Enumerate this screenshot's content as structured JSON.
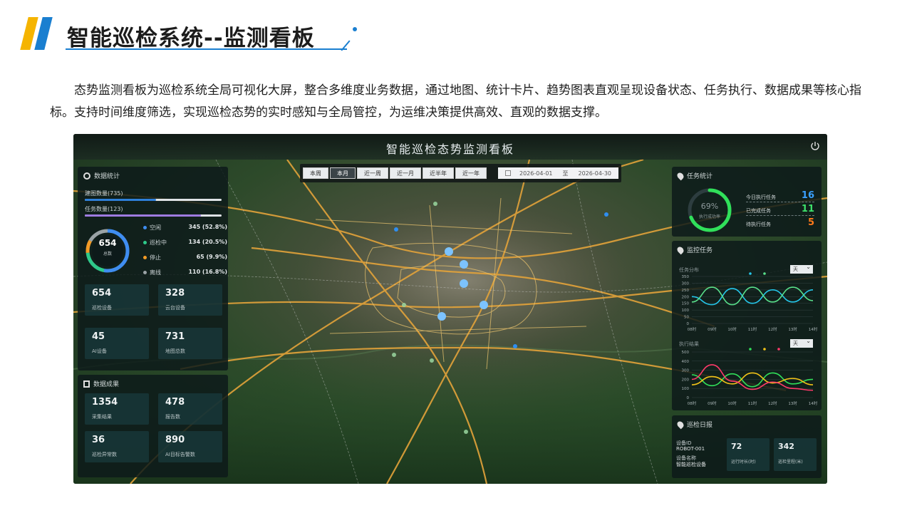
{
  "slide": {
    "title": "智能巡检系统--监测看板",
    "description": "态势监测看板为巡检系统全局可视化大屏，整合多维度业务数据，通过地图、统计卡片、趋势图表直观呈现设备状态、任务执行、数据成果等核心指标。支持时间维度筛选，实现巡检态势的实时感知与全局管控，为运维决策提供高效、直观的数据支撑。"
  },
  "dashboard": {
    "title": "智能巡检态势监测看板",
    "time_tabs": [
      "本周",
      "本月",
      "近一周",
      "近一月",
      "近半年",
      "近一年"
    ],
    "active_tab": "本月",
    "date_start": "2026-04-01",
    "date_sep": "至",
    "date_end": "2026-04-30",
    "device_stats": {
      "title": "数据统计",
      "progress": [
        {
          "label": "建图数量(735)",
          "fraction": 0.52,
          "color": "#2e7fd8"
        },
        {
          "label": "任务数量(123)",
          "fraction": 0.85,
          "color": "#9e7be0"
        }
      ],
      "donut": {
        "value": "654",
        "label": "总数"
      },
      "legend": [
        {
          "name": "空闲",
          "value": "345 (52.8%)",
          "color": "#3f8df0",
          "fraction": 0.528
        },
        {
          "name": "巡检中",
          "value": "134 (20.5%)",
          "color": "#2ec98a",
          "fraction": 0.205
        },
        {
          "name": "停止",
          "value": "65 (9.9%)",
          "color": "#f39b26",
          "fraction": 0.099
        },
        {
          "name": "离线",
          "value": "110 (16.8%)",
          "color": "#9aa3a6",
          "fraction": 0.168
        }
      ],
      "cards": [
        {
          "num": "654",
          "label": "巡检设备"
        },
        {
          "num": "328",
          "label": "云台设备"
        },
        {
          "num": "45",
          "label": "AI设备"
        },
        {
          "num": "731",
          "label": "地图总数"
        }
      ]
    },
    "data_results": {
      "title": "数据成果",
      "cards": [
        {
          "num": "1354",
          "label": "采集结果"
        },
        {
          "num": "478",
          "label": "报告数"
        },
        {
          "num": "36",
          "label": "巡检异常数"
        },
        {
          "num": "890",
          "label": "AI目标告警数"
        }
      ]
    },
    "task_stats": {
      "title": "任务统计",
      "gauge_percent": "69%",
      "gauge_fraction": 0.69,
      "gauge_label": "执行成功率",
      "rows": [
        {
          "label": "今日执行任务",
          "num": "16",
          "color": "#3aa0ff"
        },
        {
          "label": "已完成任务",
          "num": "11",
          "color": "#3ee06b"
        },
        {
          "label": "待执行任务",
          "num": "5",
          "color": "#ff7a1a"
        }
      ]
    },
    "monitor_tasks": {
      "title": "监控任务",
      "chart1_title": "任务分布",
      "chart2_title": "执行结果",
      "select_value": "天"
    },
    "inspection_log": {
      "title": "巡检日报",
      "device_id_label": "设备ID",
      "device_id": "ROBOT-001",
      "device_name_label": "设备名称",
      "device_name": "智能巡检设备",
      "cards": [
        {
          "num": "72",
          "label": "运行时长(时)"
        },
        {
          "num": "342",
          "label": "巡检里程(米)"
        }
      ]
    }
  },
  "chart_data": [
    {
      "type": "line",
      "title": "任务分布",
      "x": [
        "08时",
        "09时",
        "10时",
        "11时",
        "12时",
        "13时",
        "14时"
      ],
      "ylim": [
        0,
        350
      ],
      "yticks": [
        "350",
        "300",
        "250",
        "200",
        "150",
        "100",
        "50",
        "0"
      ],
      "series": [
        {
          "values": [
            200,
            140,
            260,
            150,
            250,
            160,
            250
          ],
          "color": "#25c7ea"
        },
        {
          "values": [
            160,
            270,
            140,
            270,
            160,
            270,
            170
          ],
          "color": "#59e08b"
        }
      ]
    },
    {
      "type": "line",
      "title": "执行结果",
      "x": [
        "08时",
        "09时",
        "10时",
        "11时",
        "12时",
        "13时",
        "14时"
      ],
      "ylim": [
        0,
        500
      ],
      "yticks": [
        "500",
        "400",
        "300",
        "200",
        "100",
        "0"
      ],
      "series": [
        {
          "values": [
            250,
            130,
            260,
            120,
            270,
            150,
            200
          ],
          "color": "#31e05a"
        },
        {
          "values": [
            140,
            230,
            150,
            270,
            160,
            210,
            140
          ],
          "color": "#f2c318"
        },
        {
          "values": [
            200,
            360,
            180,
            90,
            170,
            100,
            80
          ],
          "color": "#ff3a6a"
        }
      ]
    }
  ],
  "colors": {
    "accent_blue": "#1a7fd0",
    "accent_yellow": "#f5b400"
  }
}
